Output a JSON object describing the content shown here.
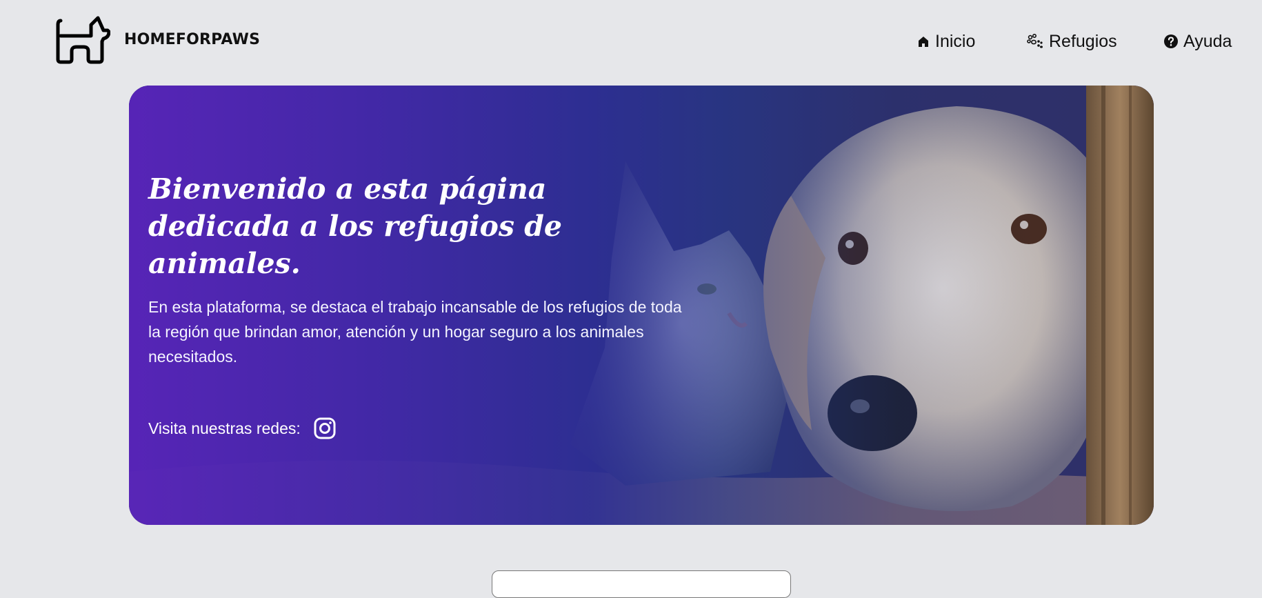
{
  "header": {
    "brand": "HOMEFORPAWS",
    "logo_icon": "dog-icon",
    "nav": [
      {
        "label": "Inicio",
        "icon": "home-icon"
      },
      {
        "label": "Refugios",
        "icon": "paw-icon"
      },
      {
        "label": "Ayuda",
        "icon": "help-circle-icon"
      }
    ]
  },
  "hero": {
    "title": "Bienvenido a esta página dedicada a los refugios de animales.",
    "description": "En esta plataforma, se destaca el trabajo incansable de los refugios de toda la región que brindan amor, atención y un hogar seguro a los animales necesitados.",
    "social_label": "Visita nuestras redes:",
    "social_icon": "instagram-icon",
    "gradient_start": "#5824b9",
    "gradient_end": "#2d2e96"
  },
  "colors": {
    "page_background": "#e6e7ea",
    "text": "#111111"
  }
}
